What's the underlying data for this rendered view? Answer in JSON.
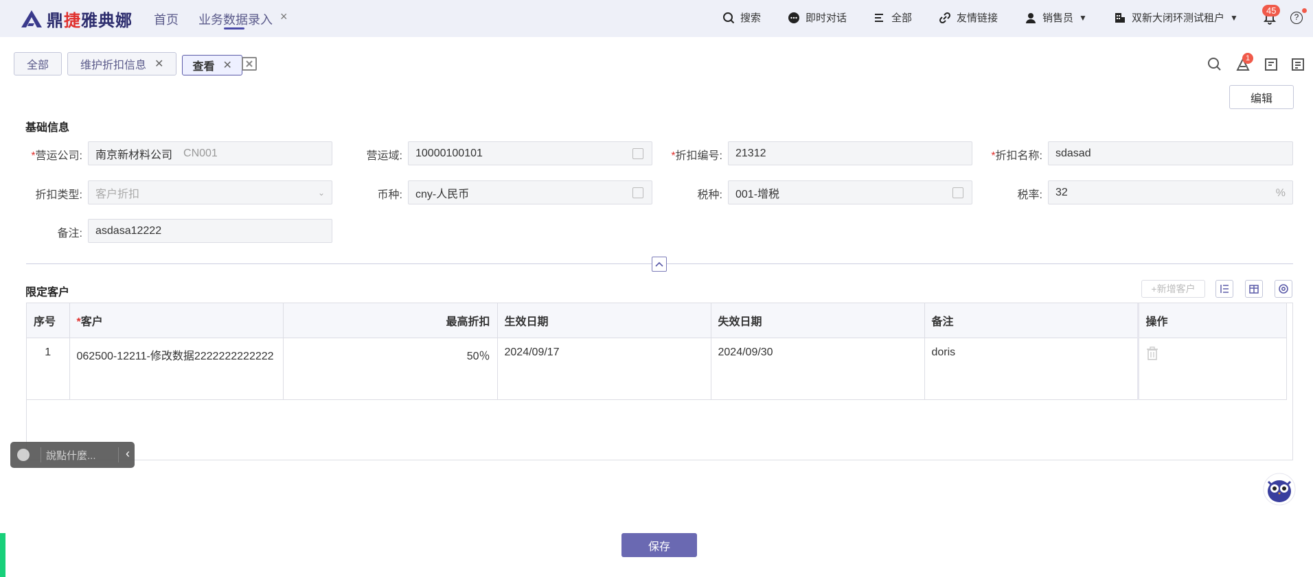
{
  "header": {
    "brand_part1": "鼎",
    "brand_red": "捷",
    "brand_part2": "雅典娜",
    "nav_home": "首页",
    "nav_tab": "业务数据录入",
    "nav_tab_close": "×",
    "search": "搜索",
    "chat": "即时对话",
    "all": "全部",
    "links": "友情链接",
    "user_role": "销售员",
    "tenant": "双新大闭环测试租户",
    "notifications": "45",
    "help": "?"
  },
  "tabs": [
    {
      "label": "全部",
      "closable": false
    },
    {
      "label": "维护折扣信息",
      "closable": true
    },
    {
      "label": "查看",
      "closable": true,
      "active": true
    }
  ],
  "toolbar": {
    "badge_count": "1",
    "edit_label": "编辑"
  },
  "basic": {
    "title": "基础信息",
    "fields": {
      "company_label": "营运公司:",
      "company_value": "南京新材料公司",
      "company_code": "CN001",
      "domain_label": "营运域:",
      "domain_value": "10000100101",
      "code_label": "折扣编号:",
      "code_value": "21312",
      "name_label": "折扣名称:",
      "name_value": "sdasad",
      "type_label": "折扣类型:",
      "type_value": "客户折扣",
      "currency_label": "币种:",
      "currency_value": "cny-人民币",
      "tax_label": "税种:",
      "tax_value": "001-增税",
      "rate_label": "税率:",
      "rate_value": "32",
      "rate_suffix": "%",
      "remark_label": "备注:",
      "remark_value": "asdasa12222"
    }
  },
  "customers": {
    "title": "限定客户",
    "add_label": "+新增客户",
    "columns": [
      "序号",
      "客户",
      "最高折扣",
      "生效日期",
      "失效日期",
      "备注",
      "操作"
    ],
    "rows": [
      {
        "no": "1",
        "customer": "062500-12211-修改数据2222222222222",
        "discount": "50％",
        "start": "2024/09/17",
        "end": "2024/09/30",
        "remark": "doris"
      }
    ]
  },
  "chat_widget": {
    "placeholder": "說點什麼..."
  },
  "footer": {
    "save_label": "保存"
  },
  "colors": {
    "primary": "#6a69b2",
    "required": "#e0312e",
    "badge": "#f05a4a"
  }
}
